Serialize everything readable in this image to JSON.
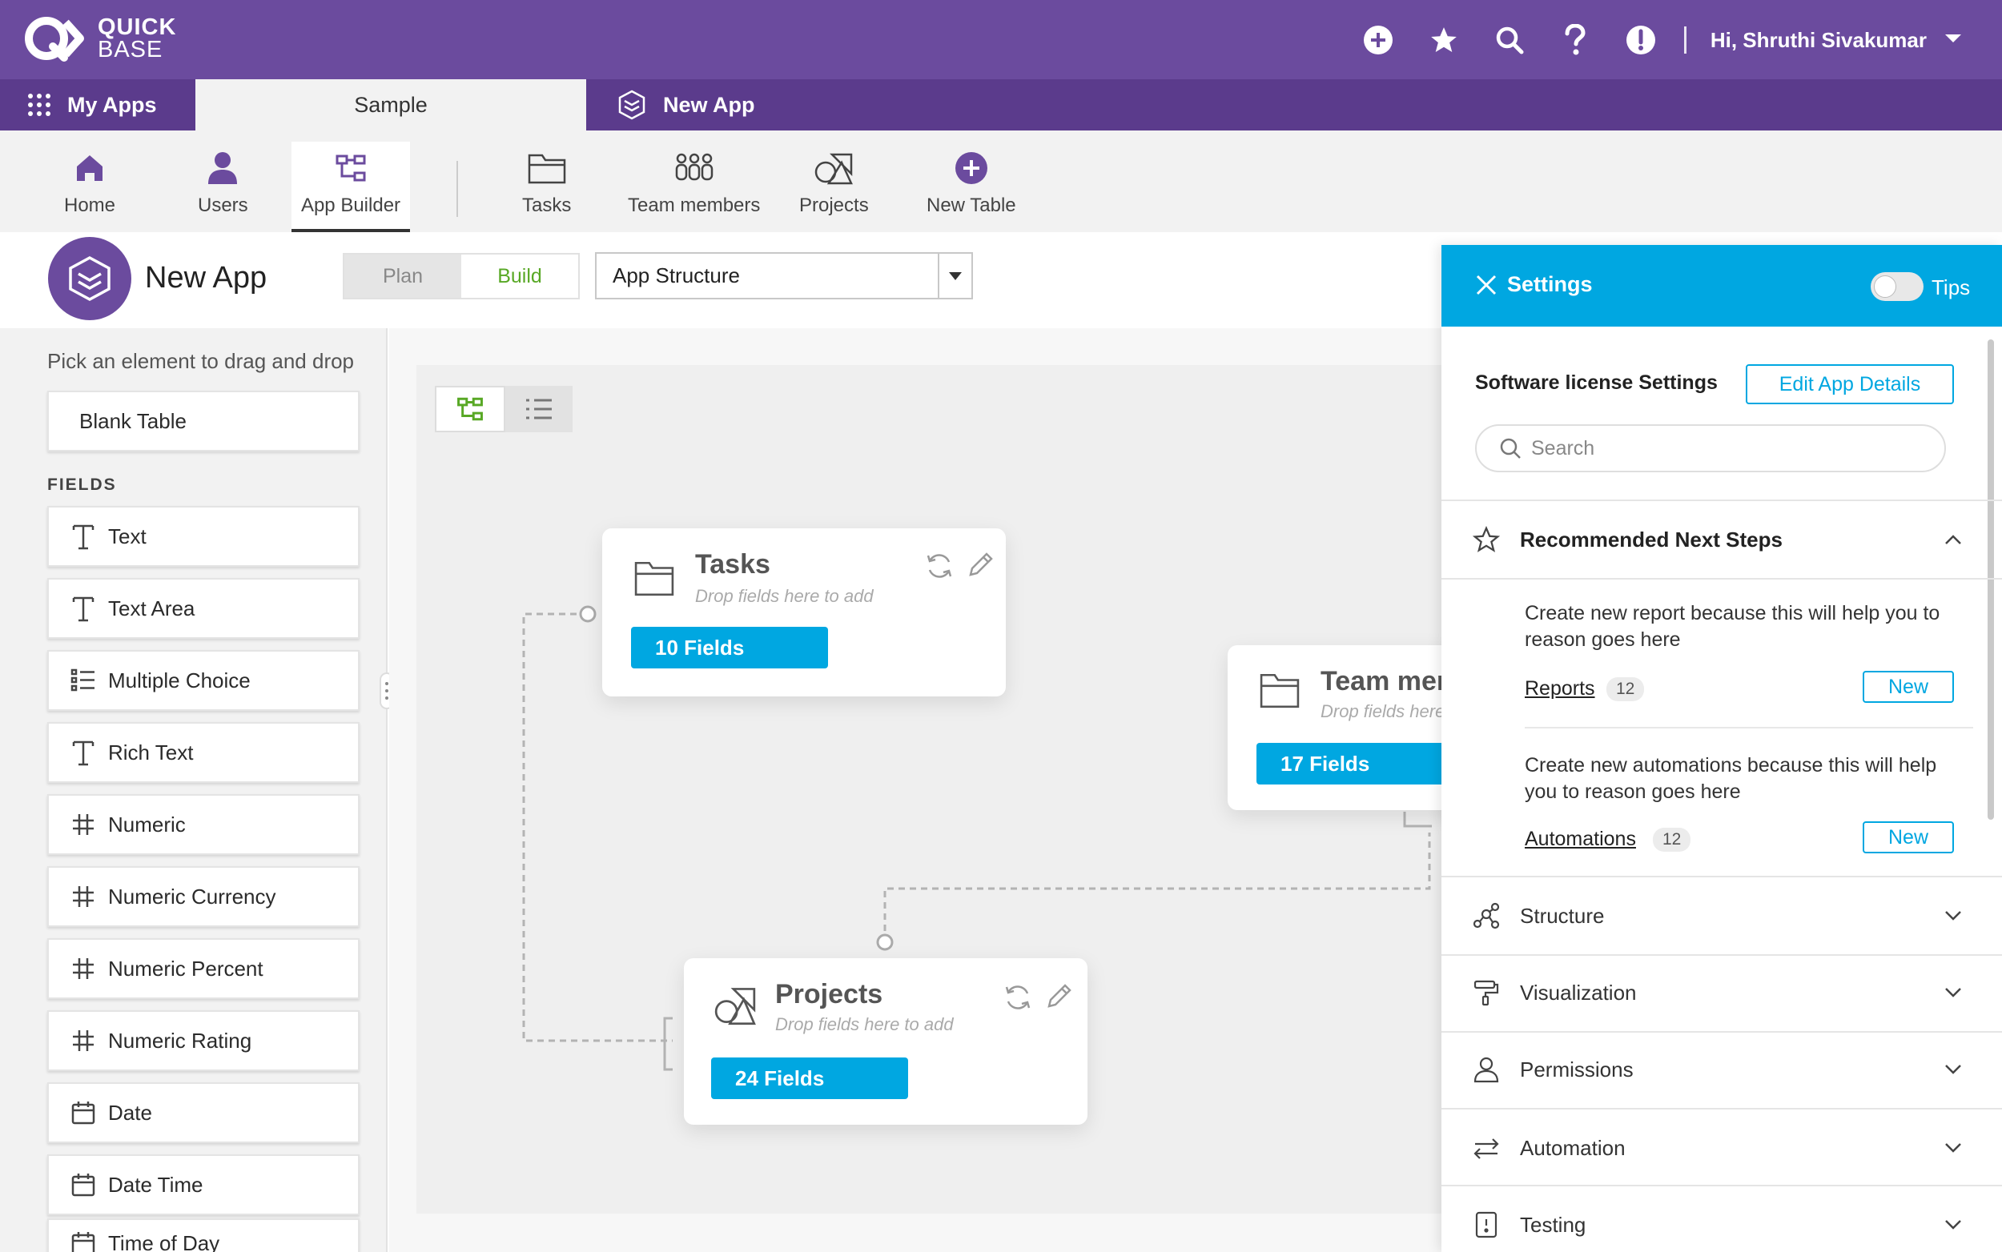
{
  "brand": {
    "line1": "QUICK",
    "line2": "BASE",
    "color": "#6b4b9e"
  },
  "topbar": {
    "icons": [
      "add-circle-icon",
      "star-icon",
      "search-icon",
      "help-icon",
      "alert-icon"
    ],
    "user_greeting": "Hi, Shruthi Sivakumar"
  },
  "tabs": {
    "my_apps": "My Apps",
    "sample": "Sample",
    "new_app": "New App"
  },
  "nav": {
    "items": [
      {
        "label": "Home",
        "icon": "home-icon"
      },
      {
        "label": "Users",
        "icon": "user-icon"
      },
      {
        "label": "App Builder",
        "icon": "app-builder-icon",
        "active": true
      },
      {
        "label": "Tasks",
        "icon": "folder-icon"
      },
      {
        "label": "Team members",
        "icon": "team-icon"
      },
      {
        "label": "Projects",
        "icon": "shapes-icon"
      },
      {
        "label": "New Table",
        "icon": "add-circle-icon"
      }
    ]
  },
  "app": {
    "title": "New App",
    "mode_plan": "Plan",
    "mode_build": "Build",
    "view_select": "App Structure"
  },
  "palette": {
    "hint": "Pick an element to drag and drop",
    "blank_table": "Blank Table",
    "fields_heading": "FIELDS",
    "fields": [
      {
        "label": "Text",
        "icon": "text-icon"
      },
      {
        "label": "Text Area",
        "icon": "text-icon"
      },
      {
        "label": "Multiple Choice",
        "icon": "list-icon"
      },
      {
        "label": "Rich Text",
        "icon": "text-icon"
      },
      {
        "label": "Numeric",
        "icon": "hash-icon"
      },
      {
        "label": "Numeric Currency",
        "icon": "hash-icon"
      },
      {
        "label": "Numeric Percent",
        "icon": "hash-icon"
      },
      {
        "label": "Numeric Rating",
        "icon": "hash-icon"
      },
      {
        "label": "Date",
        "icon": "calendar-icon"
      },
      {
        "label": "Date Time",
        "icon": "calendar-icon"
      },
      {
        "label": "Time of Day",
        "icon": "calendar-icon"
      }
    ]
  },
  "canvas": {
    "tables": [
      {
        "name": "Tasks",
        "hint": "Drop fields here to add",
        "fields": "10 Fields"
      },
      {
        "name": "Team mem",
        "hint": "Drop fields here",
        "fields": "17 Fields"
      },
      {
        "name": "Projects",
        "hint": "Drop fields here to add",
        "fields": "24 Fields"
      }
    ]
  },
  "settings": {
    "title": "Settings",
    "tips_label": "Tips",
    "tips_on": false,
    "license_title": "Software license Settings",
    "edit_details": "Edit App Details",
    "search_placeholder": "Search",
    "recommended_title": "Recommended Next Steps",
    "steps": [
      {
        "text": "Create new report because this will help you to reason goes here",
        "link": "Reports",
        "count": "12",
        "action": "New"
      },
      {
        "text": "Create new automations because this will help you to reason goes here",
        "link": "Automations",
        "count": "12",
        "action": "New"
      }
    ],
    "sections": [
      {
        "label": "Structure",
        "icon": "structure-icon"
      },
      {
        "label": "Visualization",
        "icon": "paint-roller-icon"
      },
      {
        "label": "Permissions",
        "icon": "person-icon"
      },
      {
        "label": "Automation",
        "icon": "swap-arrows-icon"
      },
      {
        "label": "Testing",
        "icon": "testing-icon"
      }
    ],
    "accent": "#00a7e1"
  }
}
